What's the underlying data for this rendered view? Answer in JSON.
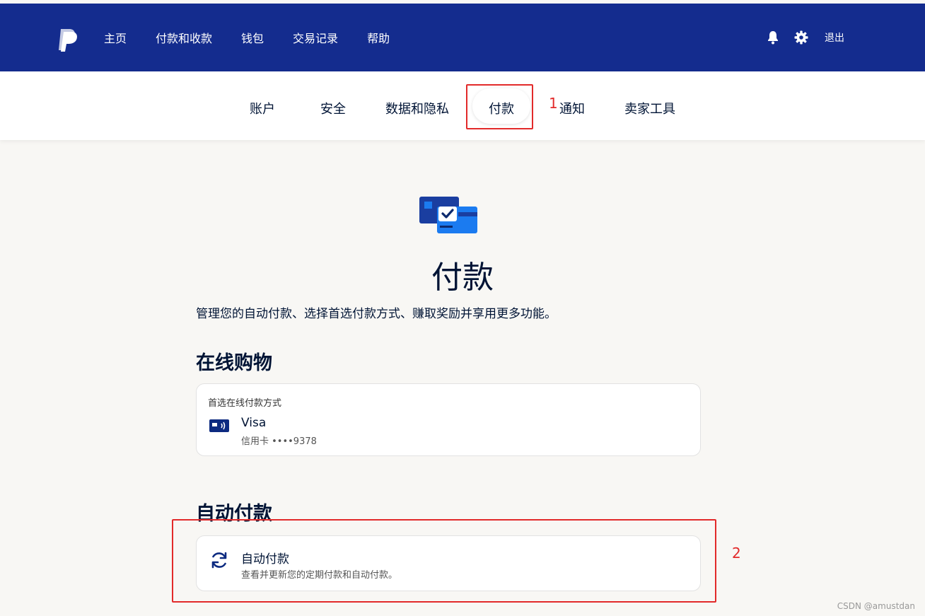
{
  "header": {
    "nav": [
      {
        "label": "主页"
      },
      {
        "label": "付款和收款"
      },
      {
        "label": "钱包"
      },
      {
        "label": "交易记录"
      },
      {
        "label": "帮助"
      }
    ],
    "logout_label": "退出",
    "icons": [
      "paypal-logo",
      "bell-icon",
      "gear-icon"
    ],
    "bg_color": "#142c8e"
  },
  "subnav": {
    "items": [
      {
        "label": "账户"
      },
      {
        "label": "安全"
      },
      {
        "label": "数据和隐私"
      },
      {
        "label": "付款"
      },
      {
        "label": "通知"
      },
      {
        "label": "卖家工具"
      }
    ],
    "active": "付款"
  },
  "annotations": {
    "one": "1",
    "two": "2",
    "color": "#e22a2a"
  },
  "main": {
    "title": "付款",
    "description": "管理您的自动付款、选择首选付款方式、赚取奖励并享用更多功能。",
    "online_shopping": {
      "heading": "在线购物",
      "caption": "首选在线付款方式",
      "method_name": "Visa",
      "method_detail": "信用卡 ••••9378"
    },
    "auto_pay": {
      "heading": "自动付款",
      "title": "自动付款",
      "description": "查看并更新您的定期付款和自动付款。"
    }
  },
  "watermark": "CSDN @amustdan"
}
